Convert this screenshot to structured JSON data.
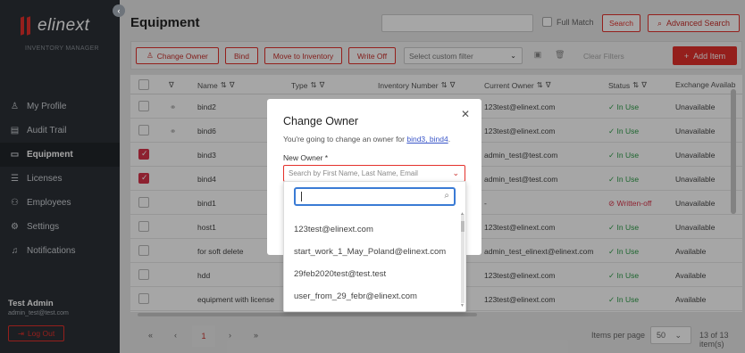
{
  "sidebar": {
    "logo_text": "elinext",
    "subtitle": "INVENTORY MANAGER",
    "items": [
      {
        "label": "My Profile",
        "icon": "user-icon",
        "glyph": "♙",
        "active": false
      },
      {
        "label": "Audit Trail",
        "icon": "document-icon",
        "glyph": "▤",
        "active": false
      },
      {
        "label": "Equipment",
        "icon": "monitor-icon",
        "glyph": "▭",
        "active": true
      },
      {
        "label": "Licenses",
        "icon": "list-icon",
        "glyph": "☰",
        "active": false
      },
      {
        "label": "Employees",
        "icon": "users-icon",
        "glyph": "⚇",
        "active": false
      },
      {
        "label": "Settings",
        "icon": "gear-icon",
        "glyph": "⚙",
        "active": false
      },
      {
        "label": "Notifications",
        "icon": "bell-icon",
        "glyph": "♫",
        "active": false
      }
    ],
    "user_name": "Test Admin",
    "user_email": "admin_test@test.com",
    "logout_label": "Log Out"
  },
  "header": {
    "title": "Equipment",
    "search_value": "",
    "full_match_label": "Full Match",
    "search_label": "Search",
    "advanced_search_label": "Advanced Search"
  },
  "toolbar": {
    "change_owner_label": "Change Owner",
    "bind_label": "Bind",
    "move_to_inventory_label": "Move to Inventory",
    "write_off_label": "Write Off",
    "custom_filter_placeholder": "Select custom filter",
    "clear_filters_label": "Clear Filters",
    "add_item_label": "Add Item"
  },
  "table": {
    "columns": [
      "Name",
      "Type",
      "Inventory Number",
      "Current Owner",
      "Status",
      "Exchange Availab"
    ],
    "rows": [
      {
        "checked": false,
        "linked": true,
        "name": "bind2",
        "type": "",
        "inventory": "",
        "owner": "123test@elinext.com",
        "status": "In Use",
        "exchange": "Unavailable"
      },
      {
        "checked": false,
        "linked": true,
        "name": "bind6",
        "type": "",
        "inventory": "",
        "owner": "123test@elinext.com",
        "status": "In Use",
        "exchange": "Unavailable"
      },
      {
        "checked": true,
        "linked": false,
        "name": "bind3",
        "type": "",
        "inventory": "",
        "owner": "admin_test@test.com",
        "status": "In Use",
        "exchange": "Unavailable"
      },
      {
        "checked": true,
        "linked": false,
        "name": "bind4",
        "type": "",
        "inventory": "",
        "owner": "admin_test@test.com",
        "status": "In Use",
        "exchange": "Unavailable"
      },
      {
        "checked": false,
        "linked": false,
        "name": "bind1",
        "type": "",
        "inventory": "",
        "owner": "-",
        "status": "Written-off",
        "exchange": "Unavailable"
      },
      {
        "checked": false,
        "linked": false,
        "name": "host1",
        "type": "",
        "inventory": "",
        "owner": "123test@elinext.com",
        "status": "In Use",
        "exchange": "Unavailable"
      },
      {
        "checked": false,
        "linked": false,
        "name": "for soft delete",
        "type": "",
        "inventory": "",
        "owner": "admin_test_elinext@elinext.com",
        "status": "In Use",
        "exchange": "Available"
      },
      {
        "checked": false,
        "linked": false,
        "name": "hdd",
        "type": "",
        "inventory": "",
        "owner": "123test@elinext.com",
        "status": "In Use",
        "exchange": "Available"
      },
      {
        "checked": false,
        "linked": false,
        "name": "equipment with license",
        "type": "",
        "inventory": "",
        "owner": "123test@elinext.com",
        "status": "In Use",
        "exchange": "Available"
      }
    ]
  },
  "pagination": {
    "first": "«",
    "prev": "‹",
    "current": "1",
    "next": "›",
    "last": "»",
    "items_per_page_label": "Items per page",
    "items_per_page_value": "50",
    "count_label": "13 of 13 item(s)"
  },
  "modal": {
    "title": "Change Owner",
    "desc_prefix": "You're going to change an owner for ",
    "desc_links": "bind3, bind4",
    "desc_suffix": ".",
    "new_owner_label": "New Owner *",
    "select_placeholder": "Search by First Name, Last Name, Email",
    "dropdown_search_value": "",
    "options": [
      "123test@elinext.com",
      "start_work_1_May_Poland@elinext.com",
      "29feb2020test@test.test",
      "user_from_29_febr@elinext.com"
    ]
  },
  "colors": {
    "accent": "#e4312b",
    "sidebar_bg": "#2b3036",
    "status_ok": "#2e9d49",
    "status_written_off": "#d9334a",
    "link": "#3a56c9"
  }
}
